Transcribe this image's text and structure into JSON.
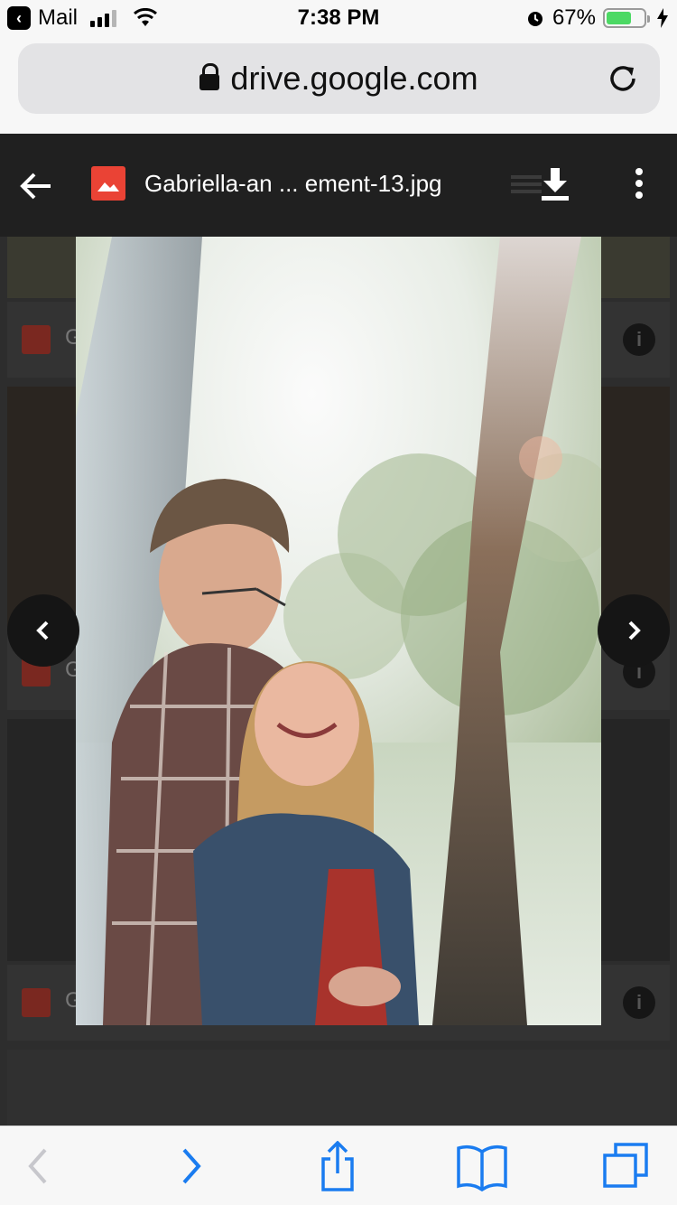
{
  "status_bar": {
    "back_app": "Mail",
    "time": "7:38 PM",
    "battery_percent_text": "67%",
    "battery_level": 0.67
  },
  "browser": {
    "url": "drive.google.com"
  },
  "viewer": {
    "file_title": "Gabriella-an ... ement-13.jpg",
    "background_row_label": "G"
  },
  "colors": {
    "file_icon": "#ea4335",
    "ios_blue": "#1a7cf0",
    "battery_green": "#4cd964"
  },
  "icons": [
    "back-arrow-icon",
    "image-file-icon",
    "list-view-icon",
    "download-icon",
    "more-vert-icon",
    "lock-icon",
    "reload-icon",
    "chevron-left-icon",
    "chevron-right-icon",
    "share-icon",
    "bookmarks-icon",
    "tabs-icon",
    "info-icon"
  ]
}
